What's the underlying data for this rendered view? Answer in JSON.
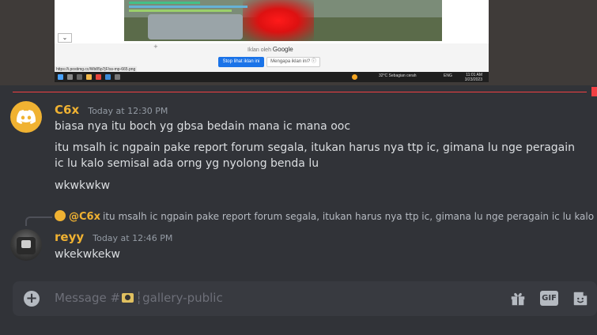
{
  "embedded_screenshot": {
    "ad_by_prefix": "Iklan oleh",
    "ad_by_brand": "Google",
    "stop_ad_button": "Stop lihat iklan ini",
    "why_ad_button": "Mengapa iklan ini? ⓘ",
    "status_url": "https://i.postimg.cc/Wb85p7jF/ss-mp-665.png",
    "weather": "32°C  Sebagian cerah",
    "language": "ENG",
    "time": "11:01 AM",
    "date": "3/23/2023"
  },
  "messages": [
    {
      "username": "C6x",
      "timestamp": "Today at 12:30 PM",
      "avatar_color": "#f0b232",
      "lines": [
        "biasa nya itu boch yg gbsa bedain mana ic mana ooc",
        "itu msalh ic ngpain pake report forum segala, itukan harus nya ttp ic, gimana lu nge peragain ic lu kalo semisal ada orng yg nyolong benda lu",
        "wkwkwkw"
      ]
    },
    {
      "reply_to": {
        "username": "@C6x",
        "text": "itu msalh ic ngpain pake report forum segala, itukan harus nya ttp ic, gimana lu nge peragain ic lu kalo semisal ada orng yg nyolong benda lu"
      },
      "username": "reyy",
      "timestamp": "Today at 12:46 PM",
      "lines": [
        "wkekwkekw"
      ]
    }
  ],
  "composer": {
    "placeholder_prefix": "Message #",
    "placeholder_channel": "┆gallery-public",
    "gif_label": "GIF"
  },
  "colors": {
    "background": "#313338",
    "username_accent": "#f0b232",
    "new_messages_line": "#f23f43",
    "input_bg": "#383a40"
  },
  "icons": [
    "discord-logo-icon",
    "add-circle-icon",
    "camera-emoji-icon",
    "gift-icon",
    "gif-icon",
    "sticker-icon"
  ]
}
